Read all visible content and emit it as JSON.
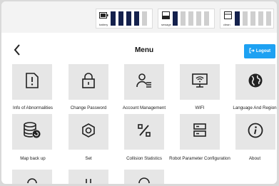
{
  "status": {
    "battery_label": "battery",
    "sewage_label": "sewage",
    "clean_label": "clean",
    "battery_level_bars": 4,
    "sewage_level_bars": 1,
    "clean_level_bars": 1
  },
  "header": {
    "title": "Menu",
    "logout_label": "Logout"
  },
  "menu": {
    "items": [
      {
        "label": "Info of Abnormalities",
        "icon": "alert-document-icon"
      },
      {
        "label": "Change Password",
        "icon": "lock-icon"
      },
      {
        "label": "Account Management",
        "icon": "user-list-icon"
      },
      {
        "label": "WIFI",
        "icon": "wifi-monitor-icon"
      },
      {
        "label": "Language And Region",
        "icon": "globe-icon"
      },
      {
        "label": "Map back up",
        "icon": "database-backup-icon"
      },
      {
        "label": "Set",
        "icon": "settings-hex-icon"
      },
      {
        "label": "Collision Statistics",
        "icon": "percent-icon"
      },
      {
        "label": "Robot Parameter Configuration",
        "icon": "server-icon"
      },
      {
        "label": "About",
        "icon": "info-icon"
      }
    ]
  },
  "colors": {
    "accent": "#1da1f2",
    "bar_on": "#14214d",
    "bar_off": "#cfcfcf",
    "tile": "#e6e6e6"
  }
}
